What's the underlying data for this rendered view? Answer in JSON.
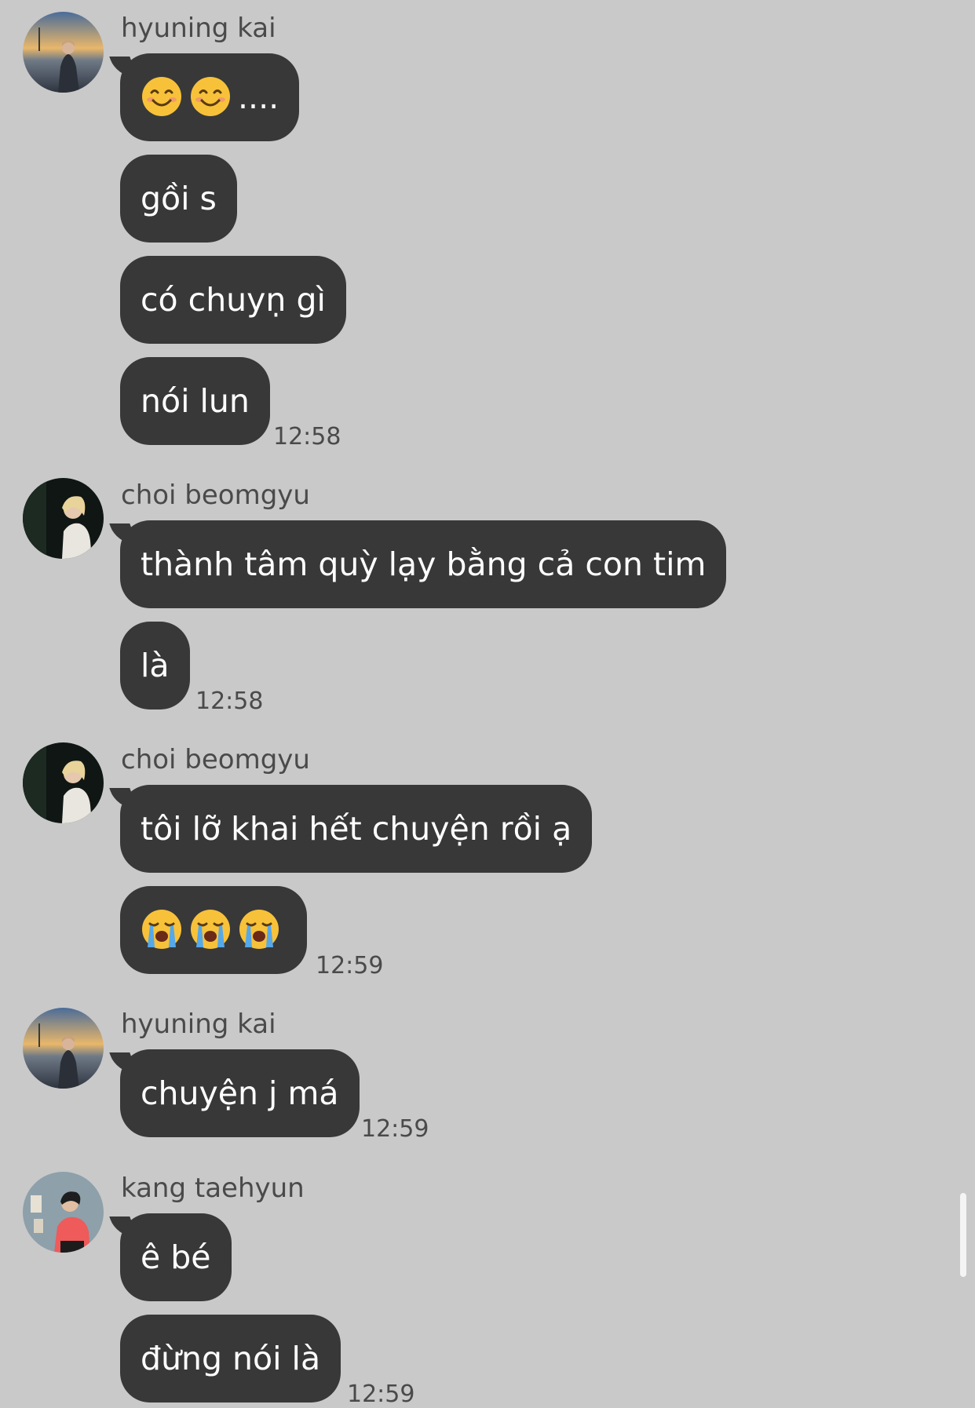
{
  "messages": [
    {
      "sender": "hyuning kai",
      "avatar": "avatar-hyuning-kai",
      "bubbles": [
        "😊 😊 ....",
        "gồi s",
        "có chuyṇ gì",
        "nói lun"
      ],
      "time": "12:58"
    },
    {
      "sender": "choi beomgyu",
      "avatar": "avatar-choi-beomgyu",
      "bubbles": [
        "thành tâm quỳ lạy bằng cả con tim",
        "là"
      ],
      "time": "12:58"
    },
    {
      "sender": "choi beomgyu",
      "avatar": "avatar-choi-beomgyu",
      "bubbles": [
        "tôi lỡ khai hết chuyện rồi ạ",
        "😭😭😭"
      ],
      "time": "12:59"
    },
    {
      "sender": "hyuning kai",
      "avatar": "avatar-hyuning-kai",
      "bubbles": [
        "chuyện j má"
      ],
      "time": "12:59"
    },
    {
      "sender": "kang taehyun",
      "avatar": "avatar-kang-taehyun",
      "bubbles": [
        "ê bé",
        "đừng nói là"
      ],
      "time": "12:59"
    }
  ],
  "emoji_text": {
    "smiling_pair": "....",
    "crying_triple": ""
  },
  "colors": {
    "background": "#c9c9c9",
    "bubble": "#383838",
    "bubble_text": "#ffffff",
    "meta_text": "#4a4a4a"
  },
  "icons": {
    "smile": "smiling-face-icon",
    "cry": "loudly-crying-face-icon"
  }
}
